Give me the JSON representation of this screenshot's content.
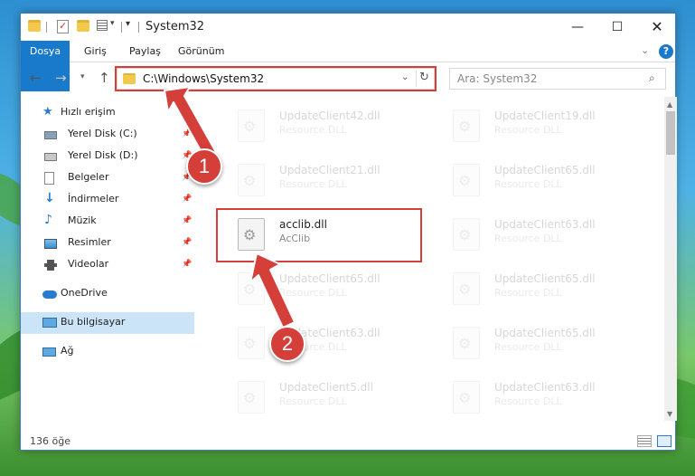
{
  "window": {
    "title": "System32",
    "controls": {
      "minimize": "—",
      "maximize": "☐",
      "close": "✕"
    }
  },
  "ribbon": {
    "tabs": [
      "Dosya",
      "Giriş",
      "Paylaş",
      "Görünüm"
    ],
    "help": "?"
  },
  "navigation": {
    "address": "C:\\Windows\\System32",
    "search_placeholder": "Ara: System32"
  },
  "sidebar": {
    "items": [
      {
        "label": "Hızlı erişim",
        "icon": "star-icon",
        "pinned": false
      },
      {
        "label": "Yerel Disk (C:)",
        "icon": "drive-icon",
        "pinned": true
      },
      {
        "label": "Yerel Disk (D:)",
        "icon": "drive-icon",
        "pinned": true
      },
      {
        "label": "Belgeler",
        "icon": "documents-icon",
        "pinned": true
      },
      {
        "label": "İndirmeler",
        "icon": "download-icon",
        "pinned": true
      },
      {
        "label": "Müzik",
        "icon": "music-icon",
        "pinned": true
      },
      {
        "label": "Resimler",
        "icon": "pictures-icon",
        "pinned": true
      },
      {
        "label": "Videolar",
        "icon": "videos-icon",
        "pinned": true
      },
      {
        "label": "OneDrive",
        "icon": "cloud-icon",
        "pinned": false
      },
      {
        "label": "Bu bilgisayar",
        "icon": "computer-icon",
        "pinned": false,
        "selected": true
      },
      {
        "label": "Ağ",
        "icon": "network-icon",
        "pinned": false
      }
    ]
  },
  "files": [
    {
      "name": "UpdateClient42.dll",
      "desc": "Resource DLL",
      "faded": true
    },
    {
      "name": "UpdateClient19.dll",
      "desc": "Resource DLL",
      "faded": true
    },
    {
      "name": "UpdateClient21.dll",
      "desc": "Resource DLL",
      "faded": true
    },
    {
      "name": "UpdateClient65.dll",
      "desc": "Resource DLL",
      "faded": true
    },
    {
      "name": "acclib.dll",
      "desc": "AcClib",
      "faded": false
    },
    {
      "name": "UpdateClient63.dll",
      "desc": "Resource DLL",
      "faded": true
    },
    {
      "name": "UpdateClient65.dll",
      "desc": "Resource DLL",
      "faded": true
    },
    {
      "name": "UpdateClient65.dll",
      "desc": "Resource DLL",
      "faded": true
    },
    {
      "name": "UpdateClient63.dll",
      "desc": "Resource DLL",
      "faded": true
    },
    {
      "name": "UpdateClient65.dll",
      "desc": "Resource DLL",
      "faded": true
    },
    {
      "name": "UpdateClient5.dll",
      "desc": "Resource DLL",
      "faded": true
    },
    {
      "name": "UpdateClient63.dll",
      "desc": "Resource DLL",
      "faded": true
    }
  ],
  "status": {
    "item_count": "136 öğe"
  },
  "steps": [
    "1",
    "2"
  ],
  "colors": {
    "accent": "#1979ca",
    "highlight": "#d43f3a",
    "selected": "#cce4f7"
  }
}
